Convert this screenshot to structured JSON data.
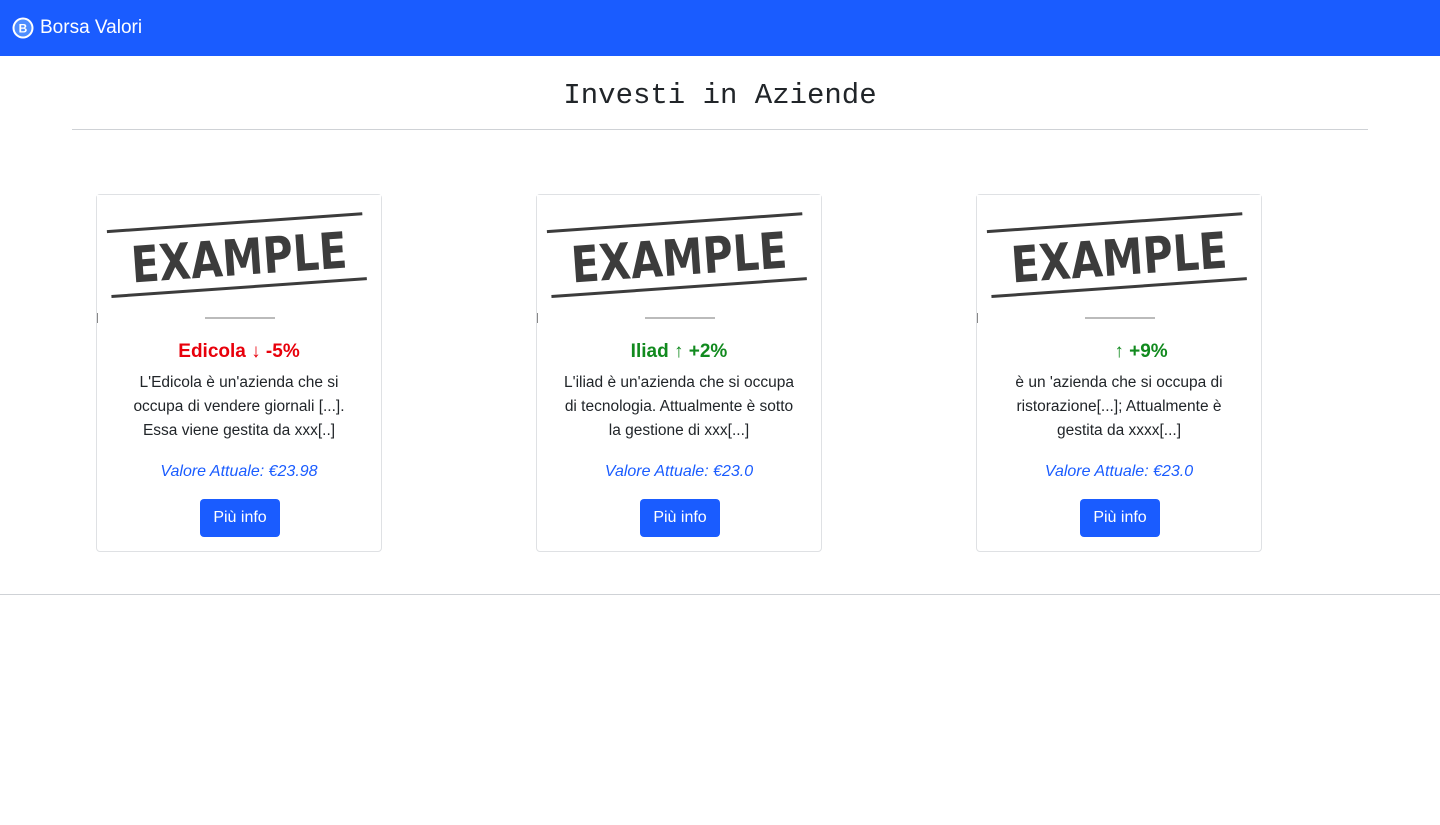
{
  "navbar": {
    "brand_label": "Borsa Valori",
    "brand_icon": "bootstrap-logo-icon",
    "brand_color": "#1a5cff"
  },
  "page": {
    "title": "Investi in Aziende"
  },
  "colors": {
    "accent": "#1a5cff",
    "down": "#e8000b",
    "up": "#118a1e"
  },
  "cards": [
    {
      "image_text": "EXAMPLE",
      "name": "Edicola",
      "arrow": "↓",
      "change": "-5%",
      "trend": "down",
      "description": "L'Edicola è un'azienda che si occupa di vendere giornali [...]. Essa viene gestita da xxx[..]",
      "price": "Valore Attuale: €23.98",
      "button_label": "Più info"
    },
    {
      "image_text": "EXAMPLE",
      "name": "Iliad",
      "arrow": "↑",
      "change": "+2%",
      "trend": "up",
      "description": "L'iliad è un'azienda che si occupa di tecnologia. Attualmente è sotto la gestione di xxx[...]",
      "price": "Valore Attuale: €23.0",
      "button_label": "Più info"
    },
    {
      "image_text": "EXAMPLE",
      "name": "",
      "arrow": "↑",
      "change": "+9%",
      "trend": "up",
      "description": "è un 'azienda che si occupa di ristorazione[...]; Attualmente è gestita da xxxx[...]",
      "price": "Valore Attuale: €23.0",
      "button_label": "Più info"
    }
  ]
}
